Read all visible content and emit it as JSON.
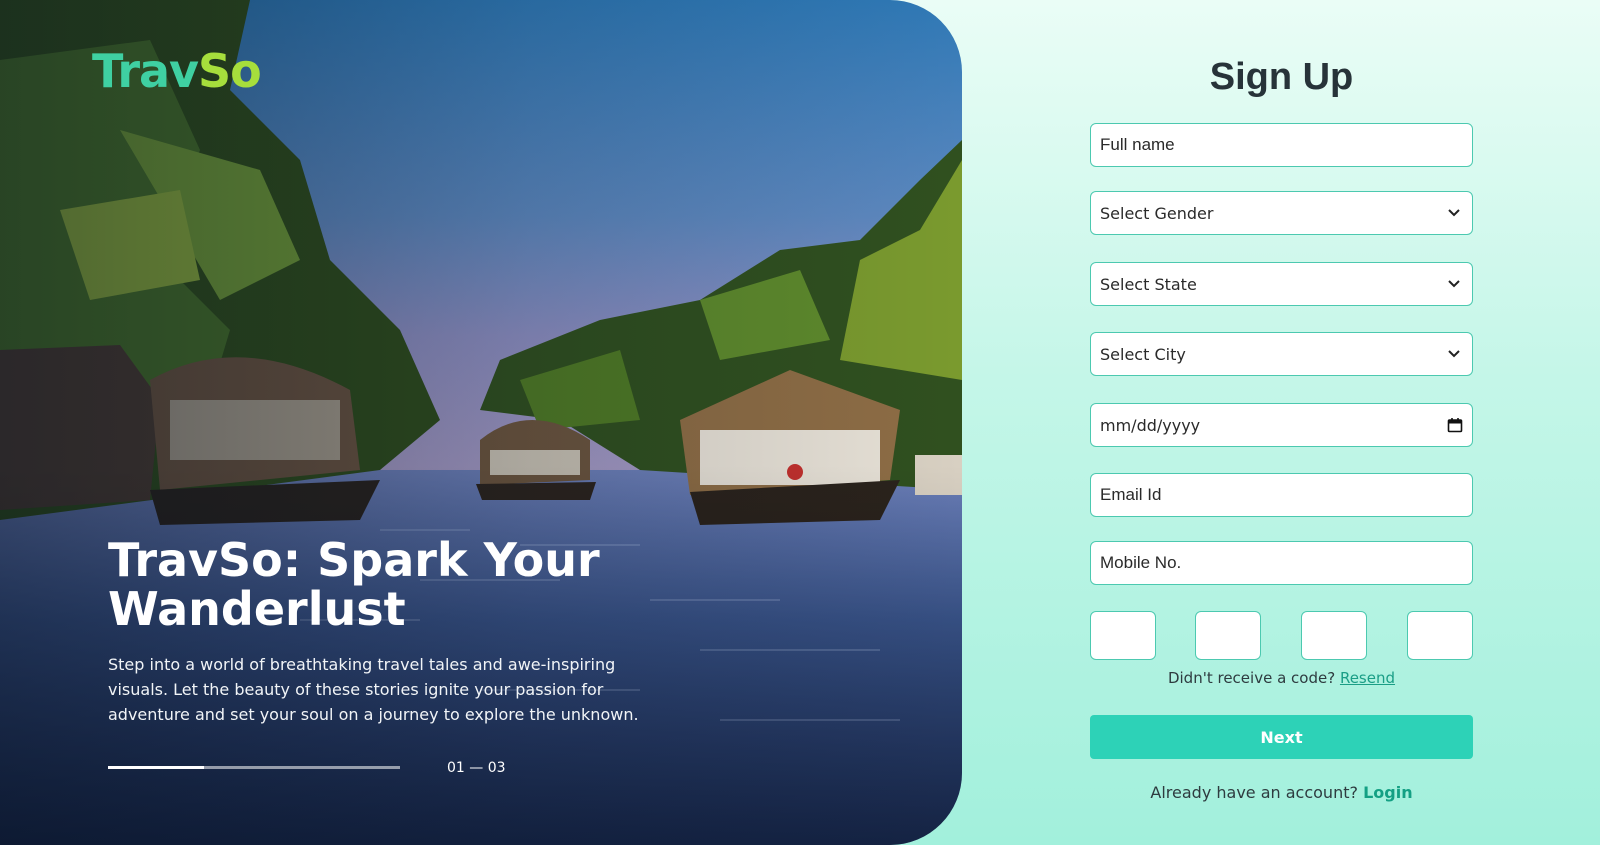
{
  "brand": {
    "logo_main": "Trav",
    "logo_accent": "So"
  },
  "hero": {
    "title": "TravSo: Spark Your Wanderlust",
    "description": "Step into a world of breathtaking travel tales and awe-inspiring visuals. Let the beauty of these stories ignite your passion for adventure and set your soul on a journey to explore the unknown.",
    "slide_counter": "01 — 03",
    "progress": 0.33
  },
  "form": {
    "title": "Sign Up",
    "full_name_placeholder": "Full name",
    "gender_label": "Select Gender",
    "state_label": "Select State",
    "city_label": "Select City",
    "dob_placeholder": "mm/dd/yyyy",
    "email_placeholder": "Email Id",
    "mobile_placeholder": "Mobile No.",
    "resend_prompt": "Didn't receive a code?",
    "resend_link": "Resend",
    "next_label": "Next",
    "login_prompt": "Already have an account?",
    "login_link": "Login"
  },
  "icons": {
    "select_arrow": "chevron-down-icon",
    "date_picker": "calendar-icon"
  },
  "colors": {
    "accent": "#2dd2b7",
    "field_border": "#4cc9b0",
    "logo_green": "#3fd0a2",
    "logo_lime": "#a6de3c"
  }
}
